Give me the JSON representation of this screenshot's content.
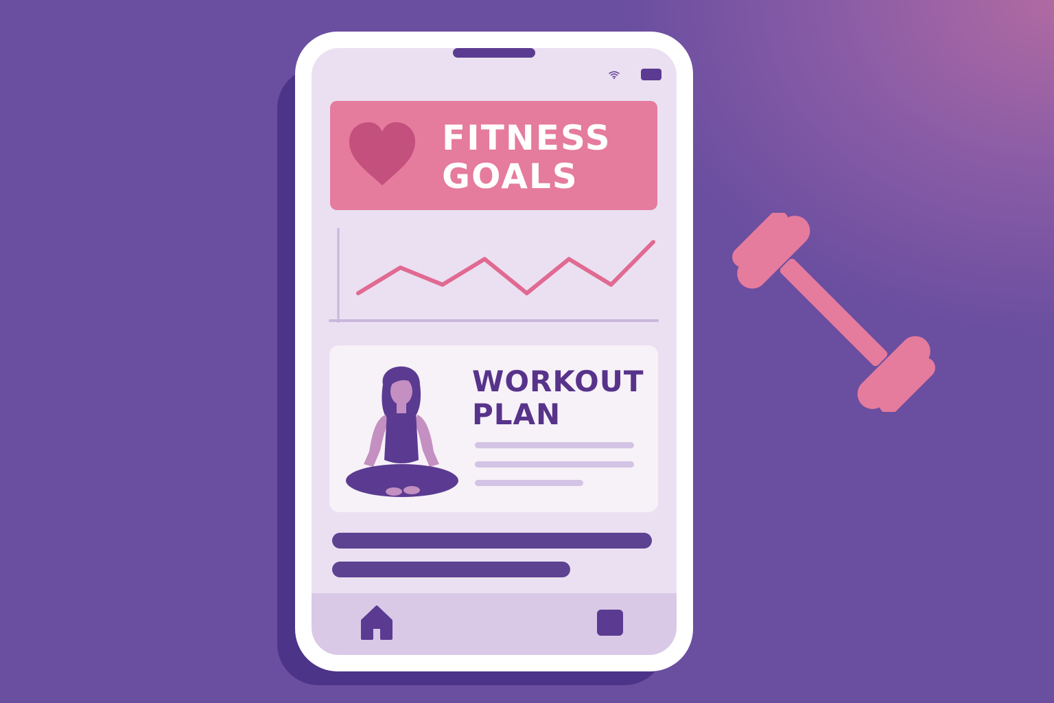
{
  "banner": {
    "title_line1": "FITNESS",
    "title_line2": "GOALS",
    "icon": "heart-icon",
    "color": "#e57b9d"
  },
  "progress_chart": {
    "chart_data": {
      "type": "line",
      "series": [
        {
          "values": [
            2,
            5,
            3,
            6,
            2,
            6,
            3,
            8
          ]
        }
      ],
      "grid": false,
      "color": "#e06a92"
    }
  },
  "workout_card": {
    "title_line1": "WORKOUT",
    "title_line2": "PLAN",
    "illustration": "meditating-person-illustration"
  },
  "bottom_nav": {
    "items": [
      {
        "icon": "home-icon"
      },
      {
        "icon": "square-icon"
      }
    ]
  },
  "status_bar": {
    "icons": [
      "wifi-icon",
      "battery-icon"
    ]
  },
  "decor": {
    "dumbbell": "dumbbell-icon",
    "accent": "#e57b9d",
    "primary": "#5b3b91",
    "background": "#6a4fa0"
  }
}
